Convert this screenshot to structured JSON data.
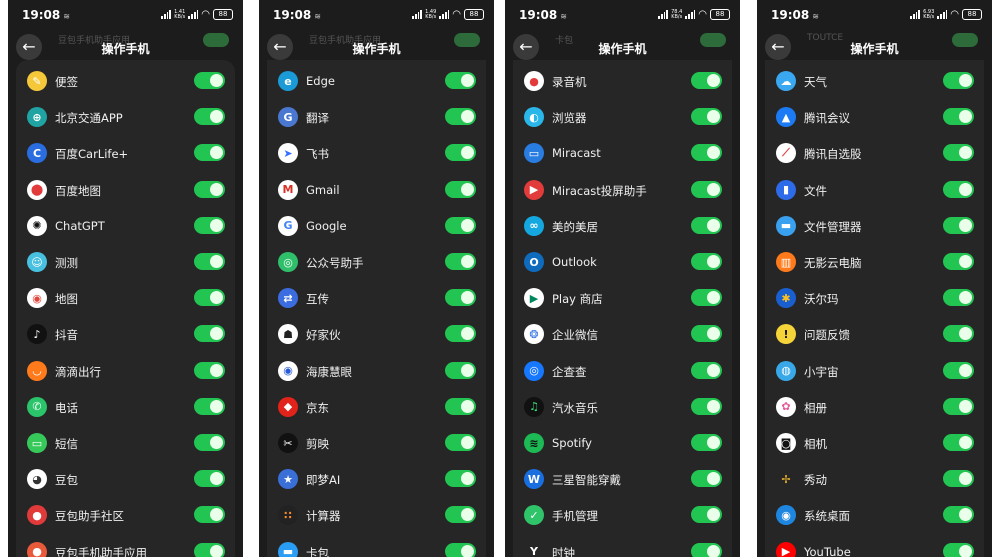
{
  "colors": {
    "panel_bg": "#1c1c1c",
    "card_bg": "#262626",
    "toggle_on": "#23c552",
    "text": "#f0f0f0"
  },
  "panels": [
    {
      "time": "19:08",
      "net_top": "1.41",
      "net_bottom": "KB/s",
      "battery": "88",
      "ghost_text": "豆包手机助手应用",
      "title": "操作手机",
      "items": [
        {
          "label": "便签",
          "icon": "note-icon",
          "bg": "#f5c83a",
          "glyph": "✎"
        },
        {
          "label": "北京交通APP",
          "icon": "transit-icon",
          "bg": "#1fa3a3",
          "glyph": "⊕"
        },
        {
          "label": "百度CarLife+",
          "icon": "carlife-icon",
          "bg": "#2a6de0",
          "glyph": "C"
        },
        {
          "label": "百度地图",
          "icon": "baidu-map-icon",
          "bg": "#ffffff",
          "fg": "#e23b3b",
          "glyph": "⬤"
        },
        {
          "label": "ChatGPT",
          "icon": "chatgpt-icon",
          "bg": "#ffffff",
          "fg": "#111111",
          "glyph": "✺"
        },
        {
          "label": "测测",
          "icon": "cece-icon",
          "bg": "#48c0e0",
          "glyph": "☺"
        },
        {
          "label": "地图",
          "icon": "map-icon",
          "bg": "#ffffff",
          "fg": "#e2463b",
          "glyph": "◉"
        },
        {
          "label": "抖音",
          "icon": "douyin-icon",
          "bg": "#111111",
          "glyph": "♪"
        },
        {
          "label": "滴滴出行",
          "icon": "didi-icon",
          "bg": "#ff7a1a",
          "glyph": "◡"
        },
        {
          "label": "电话",
          "icon": "phone-icon",
          "bg": "#2ac46a",
          "glyph": "✆"
        },
        {
          "label": "短信",
          "icon": "message-icon",
          "bg": "#37c85a",
          "glyph": "▭"
        },
        {
          "label": "豆包",
          "icon": "doubao-icon",
          "bg": "#ffffff",
          "fg": "#333333",
          "glyph": "◕"
        },
        {
          "label": "豆包助手社区",
          "icon": "doubao-community-icon",
          "bg": "#e03a3a",
          "glyph": "●"
        },
        {
          "label": "豆包手机助手应用",
          "icon": "doubao-app-icon",
          "bg": "#e85a3a",
          "glyph": "●"
        }
      ]
    },
    {
      "time": "19:08",
      "net_top": "1.49",
      "net_bottom": "KB/s",
      "battery": "88",
      "ghost_text": "豆包手机助手应用",
      "title": "操作手机",
      "items": [
        {
          "label": "Edge",
          "icon": "edge-icon",
          "bg": "#1a9bd8",
          "glyph": "e"
        },
        {
          "label": "翻译",
          "icon": "translate-icon",
          "bg": "#4a78d0",
          "glyph": "G"
        },
        {
          "label": "飞书",
          "icon": "feishu-icon",
          "bg": "#ffffff",
          "fg": "#3370ff",
          "glyph": "➤"
        },
        {
          "label": "Gmail",
          "icon": "gmail-icon",
          "bg": "#ffffff",
          "fg": "#d93025",
          "glyph": "M"
        },
        {
          "label": "Google",
          "icon": "google-icon",
          "bg": "#ffffff",
          "fg": "#4285f4",
          "glyph": "G"
        },
        {
          "label": "公众号助手",
          "icon": "gongzhonghao-icon",
          "bg": "#2fbf6a",
          "glyph": "◎"
        },
        {
          "label": "互传",
          "icon": "transfer-icon",
          "bg": "#3b6de0",
          "glyph": "⇄"
        },
        {
          "label": "好家伙",
          "icon": "haojiahuo-icon",
          "bg": "#ffffff",
          "fg": "#222222",
          "glyph": "☗"
        },
        {
          "label": "海康慧眼",
          "icon": "hikvision-icon",
          "bg": "#ffffff",
          "fg": "#2a5bd8",
          "glyph": "◉"
        },
        {
          "label": "京东",
          "icon": "jd-icon",
          "bg": "#e2231a",
          "glyph": "◆"
        },
        {
          "label": "剪映",
          "icon": "capcut-icon",
          "bg": "#111111",
          "glyph": "✂"
        },
        {
          "label": "即梦AI",
          "icon": "jimeng-icon",
          "bg": "#3a6fd8",
          "glyph": "★"
        },
        {
          "label": "计算器",
          "icon": "calculator-icon",
          "bg": "#222222",
          "fg": "#ff8a2a",
          "glyph": "∷"
        },
        {
          "label": "卡包",
          "icon": "wallet-icon",
          "bg": "#2a9df4",
          "glyph": "▬"
        }
      ]
    },
    {
      "time": "19:08",
      "net_top": "78.4",
      "net_bottom": "KB/s",
      "battery": "88",
      "ghost_text": "卡包",
      "title": "操作手机",
      "items": [
        {
          "label": "录音机",
          "icon": "recorder-icon",
          "bg": "#ffffff",
          "fg": "#e33b3b",
          "glyph": "●"
        },
        {
          "label": "浏览器",
          "icon": "browser-icon",
          "bg": "#29b6e8",
          "glyph": "◐"
        },
        {
          "label": "Miracast",
          "icon": "miracast-icon",
          "bg": "#2a7de0",
          "glyph": "▭"
        },
        {
          "label": "Miracast投屏助手",
          "icon": "miracast-helper-icon",
          "bg": "#e23b3b",
          "glyph": "▶"
        },
        {
          "label": "美的美居",
          "icon": "midea-icon",
          "bg": "#15a8e0",
          "glyph": "∞"
        },
        {
          "label": "Outlook",
          "icon": "outlook-icon",
          "bg": "#0f6cbd",
          "glyph": "O"
        },
        {
          "label": "Play 商店",
          "icon": "play-store-icon",
          "bg": "#ffffff",
          "fg": "#01875f",
          "glyph": "▶"
        },
        {
          "label": "企业微信",
          "icon": "wecom-icon",
          "bg": "#ffffff",
          "fg": "#2a6de0",
          "glyph": "❂"
        },
        {
          "label": "企查查",
          "icon": "qichacha-icon",
          "bg": "#1677ff",
          "glyph": "◎"
        },
        {
          "label": "汽水音乐",
          "icon": "qishui-icon",
          "bg": "#111111",
          "fg": "#3ee07a",
          "glyph": "♫"
        },
        {
          "label": "Spotify",
          "icon": "spotify-icon",
          "bg": "#1db954",
          "fg": "#111111",
          "glyph": "≋"
        },
        {
          "label": "三星智能穿戴",
          "icon": "galaxy-wearable-icon",
          "bg": "#1a6fe0",
          "glyph": "W"
        },
        {
          "label": "手机管理",
          "icon": "phone-manager-icon",
          "bg": "#2fc46a",
          "glyph": "✓"
        },
        {
          "label": "时钟",
          "icon": "clock-icon",
          "bg": "#262626",
          "fg": "#ffffff",
          "glyph": "Y"
        }
      ]
    },
    {
      "time": "19:08",
      "net_top": "6.93",
      "net_bottom": "KB/s",
      "battery": "88",
      "ghost_text": "TOUTCE",
      "title": "操作手机",
      "items": [
        {
          "label": "天气",
          "icon": "weather-icon",
          "bg": "#3aa8f0",
          "glyph": "☁"
        },
        {
          "label": "腾讯会议",
          "icon": "tencent-meeting-icon",
          "bg": "#1c7bf4",
          "glyph": "▲"
        },
        {
          "label": "腾讯自选股",
          "icon": "tencent-stock-icon",
          "bg": "#ffffff",
          "fg": "#e23b3b",
          "glyph": "⟋"
        },
        {
          "label": "文件",
          "icon": "files-icon",
          "bg": "#2d6be8",
          "glyph": "▮"
        },
        {
          "label": "文件管理器",
          "icon": "file-manager-icon",
          "bg": "#3aa0f0",
          "glyph": "▬"
        },
        {
          "label": "无影云电脑",
          "icon": "wuying-icon",
          "bg": "#ff7a1a",
          "glyph": "▥"
        },
        {
          "label": "沃尔玛",
          "icon": "walmart-icon",
          "bg": "#1a5fd0",
          "fg": "#ffc220",
          "glyph": "✱"
        },
        {
          "label": "问题反馈",
          "icon": "feedback-icon",
          "bg": "#f5d43a",
          "fg": "#111111",
          "glyph": "!"
        },
        {
          "label": "小宇宙",
          "icon": "xiaoyuzhou-icon",
          "bg": "#39a8e8",
          "glyph": "◍"
        },
        {
          "label": "相册",
          "icon": "gallery-icon",
          "bg": "#ffffff",
          "fg": "#e45a9a",
          "glyph": "✿"
        },
        {
          "label": "相机",
          "icon": "camera-icon",
          "bg": "#ffffff",
          "fg": "#111111",
          "glyph": "◙"
        },
        {
          "label": "秀动",
          "icon": "xiudong-icon",
          "bg": "#262626",
          "fg": "#f2b92a",
          "glyph": "✢"
        },
        {
          "label": "系统桌面",
          "icon": "launcher-icon",
          "bg": "#1f86e0",
          "glyph": "◉"
        },
        {
          "label": "YouTube",
          "icon": "youtube-icon",
          "bg": "#ff0000",
          "glyph": "▶"
        }
      ]
    }
  ]
}
